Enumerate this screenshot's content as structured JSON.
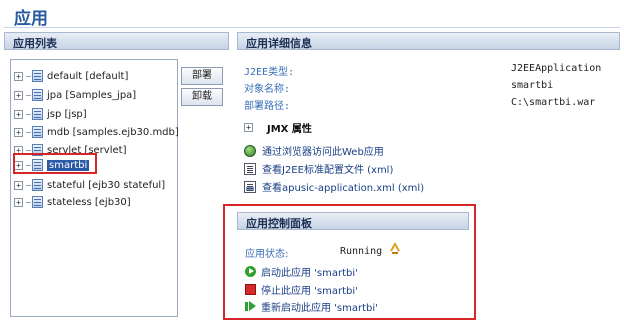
{
  "page": {
    "title": "应用"
  },
  "left_panel": {
    "header": "应用列表",
    "tree": [
      {
        "label": "default [default]",
        "selected": false
      },
      {
        "label": "jpa [Samples_jpa]",
        "selected": false
      },
      {
        "label": "jsp [jsp]",
        "selected": false
      },
      {
        "label": "mdb [samples.ejb30.mdb]",
        "selected": false
      },
      {
        "label": "servlet [servlet]",
        "selected": false
      },
      {
        "label": "smartbi",
        "selected": true
      },
      {
        "label": "stateful [ejb30 stateful]",
        "selected": false
      },
      {
        "label": "stateless [ejb30]",
        "selected": false
      }
    ],
    "deploy_button": "部署",
    "undeploy_button": "卸载"
  },
  "detail": {
    "header": "应用详细信息",
    "rows": [
      {
        "label": "J2EE类型:",
        "value": "J2EEApplication"
      },
      {
        "label": "对象名称:",
        "value": "smartbi"
      },
      {
        "label": "部署路径:",
        "value": "C:\\smartbi.war"
      }
    ],
    "jmx_label": "JMX 属性",
    "links": [
      {
        "icon": "globe-icon",
        "text": "通过浏览器访问此Web应用"
      },
      {
        "icon": "document-icon",
        "text": "查看J2EE标准配置文件 (xml)"
      },
      {
        "icon": "document-a-icon",
        "text": "查看apusic-application.xml (xml)"
      }
    ]
  },
  "control": {
    "header": "应用控制面板",
    "status_label": "应用状态:",
    "status_value": "Running",
    "actions": [
      {
        "icon": "start-icon",
        "text": "启动此应用 'smartbi'"
      },
      {
        "icon": "stop-icon",
        "text": "停止此应用 'smartbi'"
      },
      {
        "icon": "restart-icon",
        "text": "重新启动此应用 'smartbi'"
      }
    ]
  },
  "colors": {
    "accent": "#2a5a9e",
    "link": "#1a3f86",
    "highlight_border": "#d6262a",
    "selection": "#2c58a8"
  }
}
